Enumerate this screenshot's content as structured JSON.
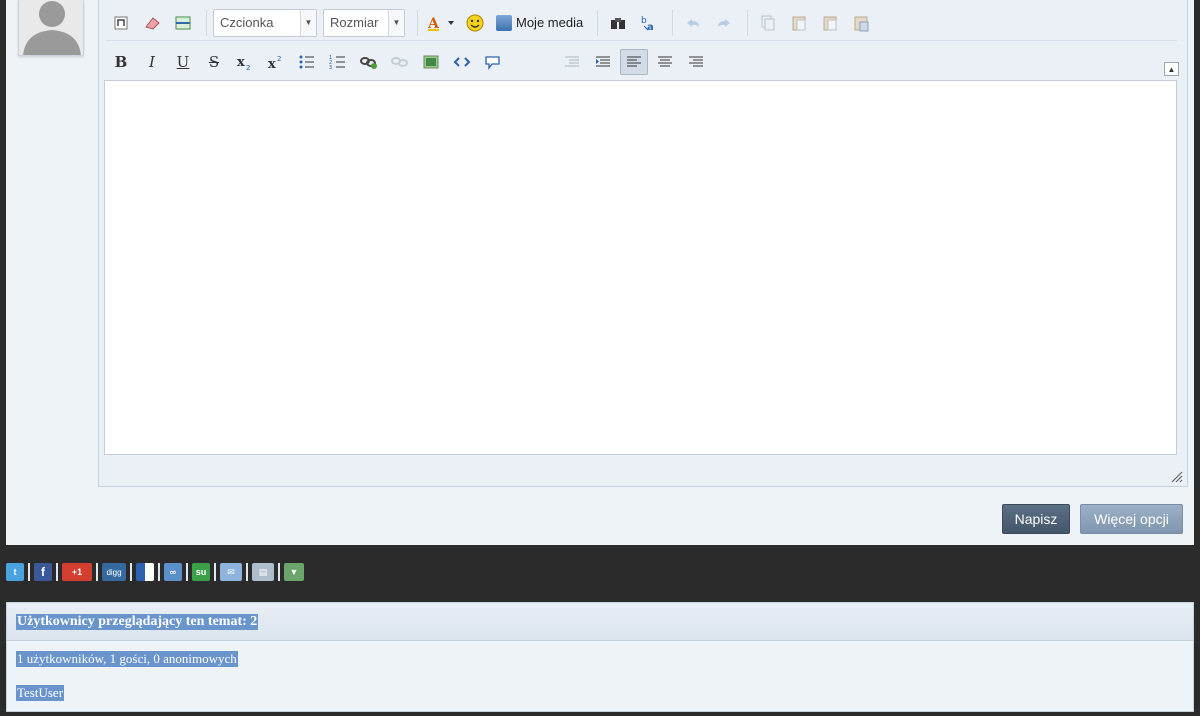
{
  "editor": {
    "font_combo": "Czcionka",
    "size_combo": "Rozmiar",
    "media_label": "Moje media"
  },
  "buttons": {
    "submit": "Napisz",
    "more_options": "Więcej opcji"
  },
  "share": {
    "gplus_label": "+1",
    "digg_label": "digg",
    "stumble_label": "su"
  },
  "viewers": {
    "title": "Użytkownicy przeglądający ten temat: 2",
    "summary": "1 użytkowników, 1 gości, 0 anonimowych",
    "users": "TestUser"
  },
  "colors": {
    "panel_bg": "#eef3f8",
    "page_bg": "#2b2b2b",
    "primary_btn": "#4d6075",
    "secondary_btn": "#8ea3ba",
    "selection": "#6a95cc"
  }
}
